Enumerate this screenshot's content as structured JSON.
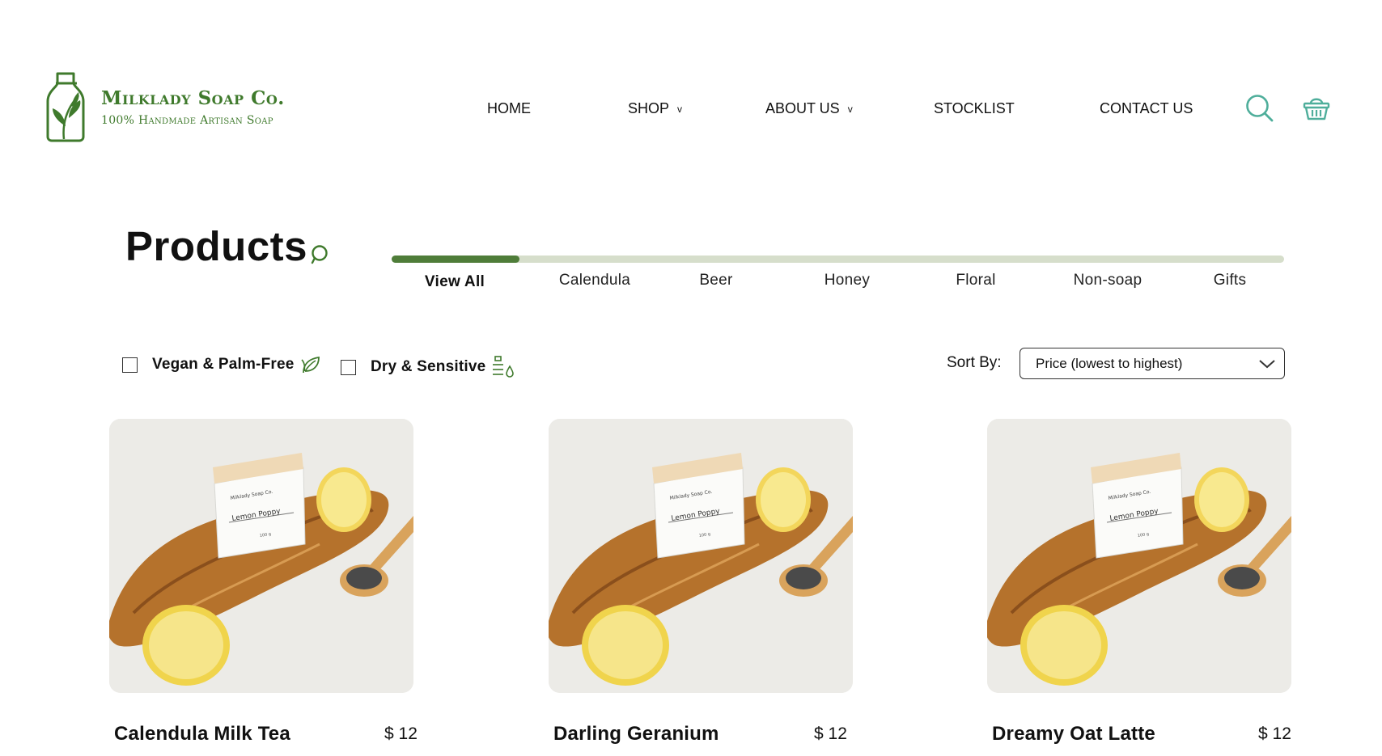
{
  "brand": {
    "name": "Milklady Soap Co.",
    "tagline": "100% Handmade Artisan Soap",
    "color": "#3f7a2c"
  },
  "nav": {
    "items": [
      {
        "label": "HOME",
        "has_dropdown": false
      },
      {
        "label": "SHOP",
        "has_dropdown": true
      },
      {
        "label": "ABOUT US",
        "has_dropdown": true
      },
      {
        "label": "STOCKLIST",
        "has_dropdown": false
      },
      {
        "label": "CONTACT US",
        "has_dropdown": false
      }
    ],
    "caret": "v",
    "icons": [
      "search-icon",
      "basket-icon"
    ],
    "icon_color": "#4fae9b"
  },
  "page": {
    "title": "Products"
  },
  "tabs": {
    "items": [
      "View All",
      "Calendula",
      "Beer",
      "Honey",
      "Floral",
      "Non-soap",
      "Gifts"
    ],
    "active_index": 0,
    "active_color": "#4f7d39",
    "track_color": "#d6decb"
  },
  "filters": [
    {
      "label": "Vegan & Palm-Free",
      "checked": false,
      "icon": "leaf-icon"
    },
    {
      "label": "Dry & Sensitive",
      "checked": false,
      "icon": "lotion-drop-icon"
    }
  ],
  "sort": {
    "label": "Sort By:",
    "selected": "Price (lowest to highest)"
  },
  "products": [
    {
      "name": "Calendula Milk Tea",
      "price": "$ 12"
    },
    {
      "name": "Darling Geranium",
      "price": "$ 12"
    },
    {
      "name": "Dreamy Oat Latte",
      "price": "$ 12"
    }
  ],
  "product_image": {
    "soap_label_line1": "Milklady Soap Co.",
    "soap_label_line2": "Lemon Poppy",
    "soap_label_line3": "100 g"
  }
}
